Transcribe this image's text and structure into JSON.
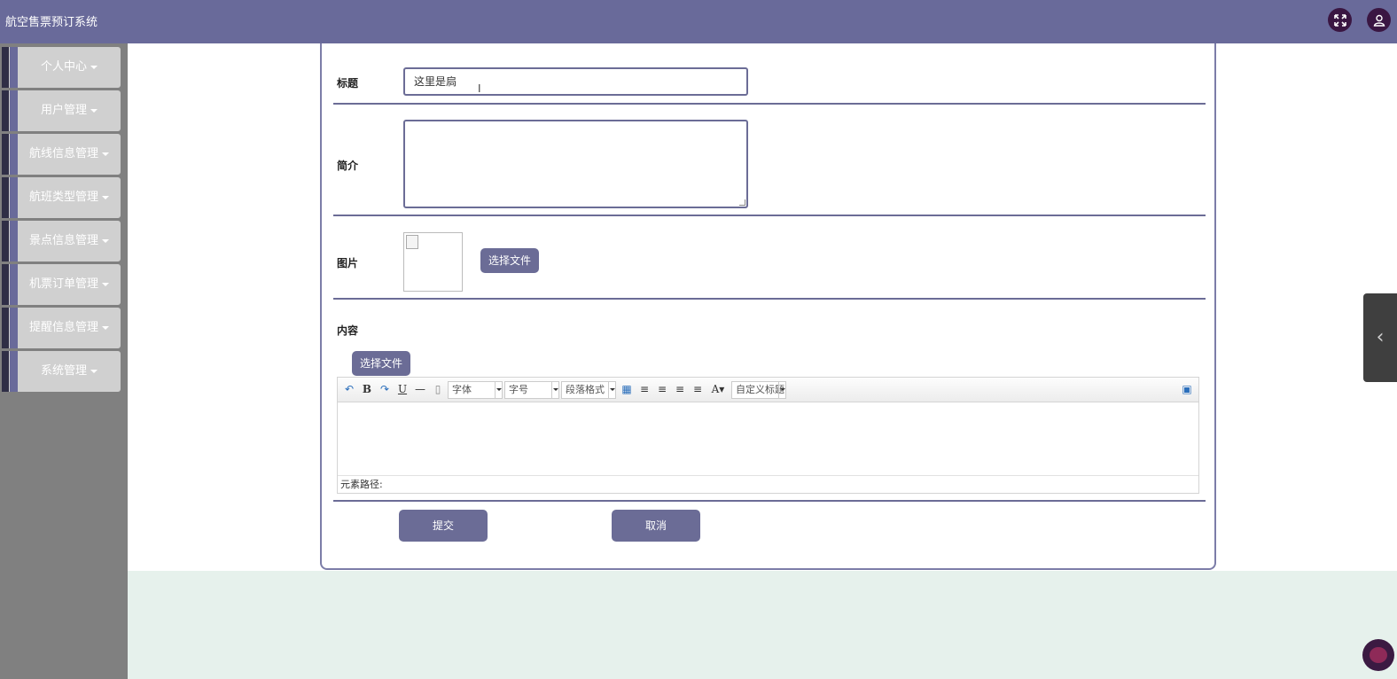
{
  "header": {
    "title": "航空售票预订系统",
    "fullscreen_icon": "fullscreen-icon",
    "user_icon": "user-icon"
  },
  "sidebar": {
    "items": [
      {
        "label": "个人中心"
      },
      {
        "label": "用户管理"
      },
      {
        "label": "航线信息管理"
      },
      {
        "label": "航班类型管理"
      },
      {
        "label": "景点信息管理"
      },
      {
        "label": "机票订单管理"
      },
      {
        "label": "提醒信息管理"
      },
      {
        "label": "系统管理"
      }
    ]
  },
  "form": {
    "title_label": "标题",
    "title_value": "这里是扃",
    "summary_label": "简介",
    "summary_value": "",
    "image_label": "图片",
    "image_button": "选择文件",
    "content_label": "内容",
    "content_button": "选择文件",
    "submit_label": "提交",
    "cancel_label": "取消"
  },
  "editor": {
    "font_select": "字体",
    "size_select": "字号",
    "paragraph_select": "段落格式",
    "custom_title_select": "自定义标题",
    "path_label": "元素路径:"
  },
  "colors": {
    "primary": "#696a9a",
    "sidebar_bg": "#808080",
    "page_bottom_bg": "#e6f1ec"
  }
}
